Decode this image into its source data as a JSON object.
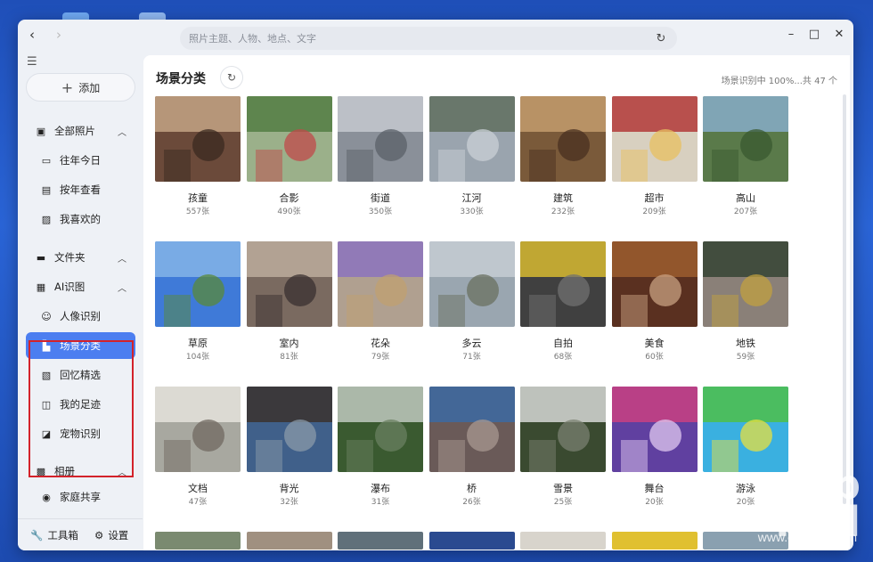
{
  "search": {
    "placeholder": "照片主题、人物、地点、文字"
  },
  "sidebar": {
    "add_label": "添加",
    "items": [
      {
        "label": "全部照片",
        "icon": "photos-icon",
        "group": true
      },
      {
        "label": "往年今日",
        "icon": "calendar-icon",
        "group": false
      },
      {
        "label": "按年查看",
        "icon": "year-icon",
        "group": false
      },
      {
        "label": "我喜欢的",
        "icon": "heart-image-icon",
        "group": false
      },
      {
        "label": "文件夹",
        "icon": "folder-icon",
        "group": true
      },
      {
        "label": "AI识图",
        "icon": "ai-image-icon",
        "group": true
      },
      {
        "label": "人像识别",
        "icon": "face-icon",
        "group": false
      },
      {
        "label": "场景分类",
        "icon": "scene-icon",
        "group": false,
        "active": true
      },
      {
        "label": "回忆精选",
        "icon": "memory-icon",
        "group": false
      },
      {
        "label": "我的足迹",
        "icon": "footprint-icon",
        "group": false
      },
      {
        "label": "宠物识别",
        "icon": "pet-icon",
        "group": false
      },
      {
        "label": "相册",
        "icon": "album-icon",
        "group": true
      },
      {
        "label": "家庭共享",
        "icon": "family-icon",
        "group": false
      }
    ],
    "toolbox_label": "工具箱",
    "settings_label": "设置"
  },
  "main": {
    "title": "场景分类",
    "status": "场景识别中 100%...共 47 个"
  },
  "scenes": [
    {
      "label": "孩童",
      "count": "557张"
    },
    {
      "label": "合影",
      "count": "490张"
    },
    {
      "label": "街道",
      "count": "350张"
    },
    {
      "label": "江河",
      "count": "330张"
    },
    {
      "label": "建筑",
      "count": "232张"
    },
    {
      "label": "超市",
      "count": "209张"
    },
    {
      "label": "高山",
      "count": "207张"
    },
    {
      "label": "草原",
      "count": "104张"
    },
    {
      "label": "室内",
      "count": "81张"
    },
    {
      "label": "花朵",
      "count": "79张"
    },
    {
      "label": "多云",
      "count": "71张"
    },
    {
      "label": "自拍",
      "count": "68张"
    },
    {
      "label": "美食",
      "count": "60张"
    },
    {
      "label": "地铁",
      "count": "59张"
    },
    {
      "label": "文档",
      "count": "47张"
    },
    {
      "label": "背光",
      "count": "32张"
    },
    {
      "label": "瀑布",
      "count": "31张"
    },
    {
      "label": "桥",
      "count": "26张"
    },
    {
      "label": "雪景",
      "count": "25张"
    },
    {
      "label": "舞台",
      "count": "20张"
    },
    {
      "label": "游泳",
      "count": "20张"
    }
  ],
  "colors": {
    "accent": "#4c7ef0",
    "highlight_box": "#d3222a"
  },
  "watermark": {
    "text": "www.chiphell.com",
    "logo": "chip hell"
  }
}
